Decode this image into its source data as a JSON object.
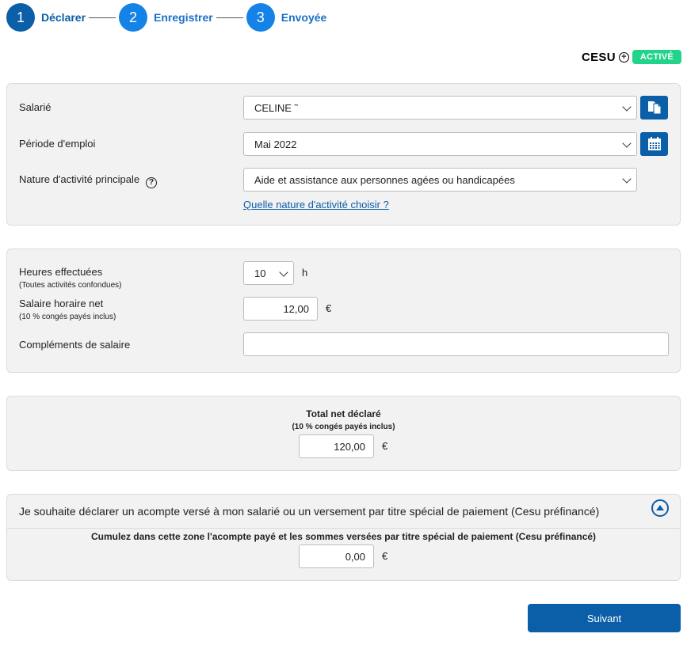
{
  "stepper": {
    "steps": [
      {
        "number": "1",
        "label": "Déclarer"
      },
      {
        "number": "2",
        "label": "Enregistrer"
      },
      {
        "number": "3",
        "label": "Envoyée"
      }
    ]
  },
  "cesu": {
    "title": "CESU",
    "plus": "+",
    "badge": "ACTIVÉ"
  },
  "employee_panel": {
    "salarie_label": "Salarié",
    "salarie_value": "CELINE ˜",
    "periode_label": "Période d'emploi",
    "periode_value": "Mai 2022",
    "nature_label": "Nature d'activité principale",
    "nature_help": "?",
    "nature_value": "Aide et assistance aux personnes agées ou handicapées",
    "nature_link": "Quelle nature d'activité choisir ?"
  },
  "hours_panel": {
    "heures_label": "Heures effectuées",
    "heures_sublabel": "(Toutes activités confondues)",
    "heures_value": "10",
    "heures_unit": "h",
    "salaire_label": "Salaire horaire net",
    "salaire_sublabel": "(10 % congés payés inclus)",
    "salaire_value": "12,00",
    "salaire_unit": "€",
    "complements_label": "Compléments de salaire",
    "complements_value": ""
  },
  "total_panel": {
    "title": "Total net déclaré",
    "subtitle": "(10 % congés payés inclus)",
    "value": "120,00",
    "unit": "€"
  },
  "acompte_panel": {
    "header": "Je souhaite déclarer un acompte versé à mon salarié ou un versement par titre spécial de paiement (Cesu préfinancé)",
    "instruction": "Cumulez dans cette zone l'acompte payé et les sommes versées par titre spécial de paiement (Cesu préfinancé)",
    "value": "0,00",
    "unit": "€"
  },
  "actions": {
    "next_label": "Suivant"
  },
  "colors": {
    "primary": "#0b5ea8",
    "step_todo": "#1482e6",
    "badge_green": "#22d38a",
    "panel_bg": "#f2f2f2"
  }
}
